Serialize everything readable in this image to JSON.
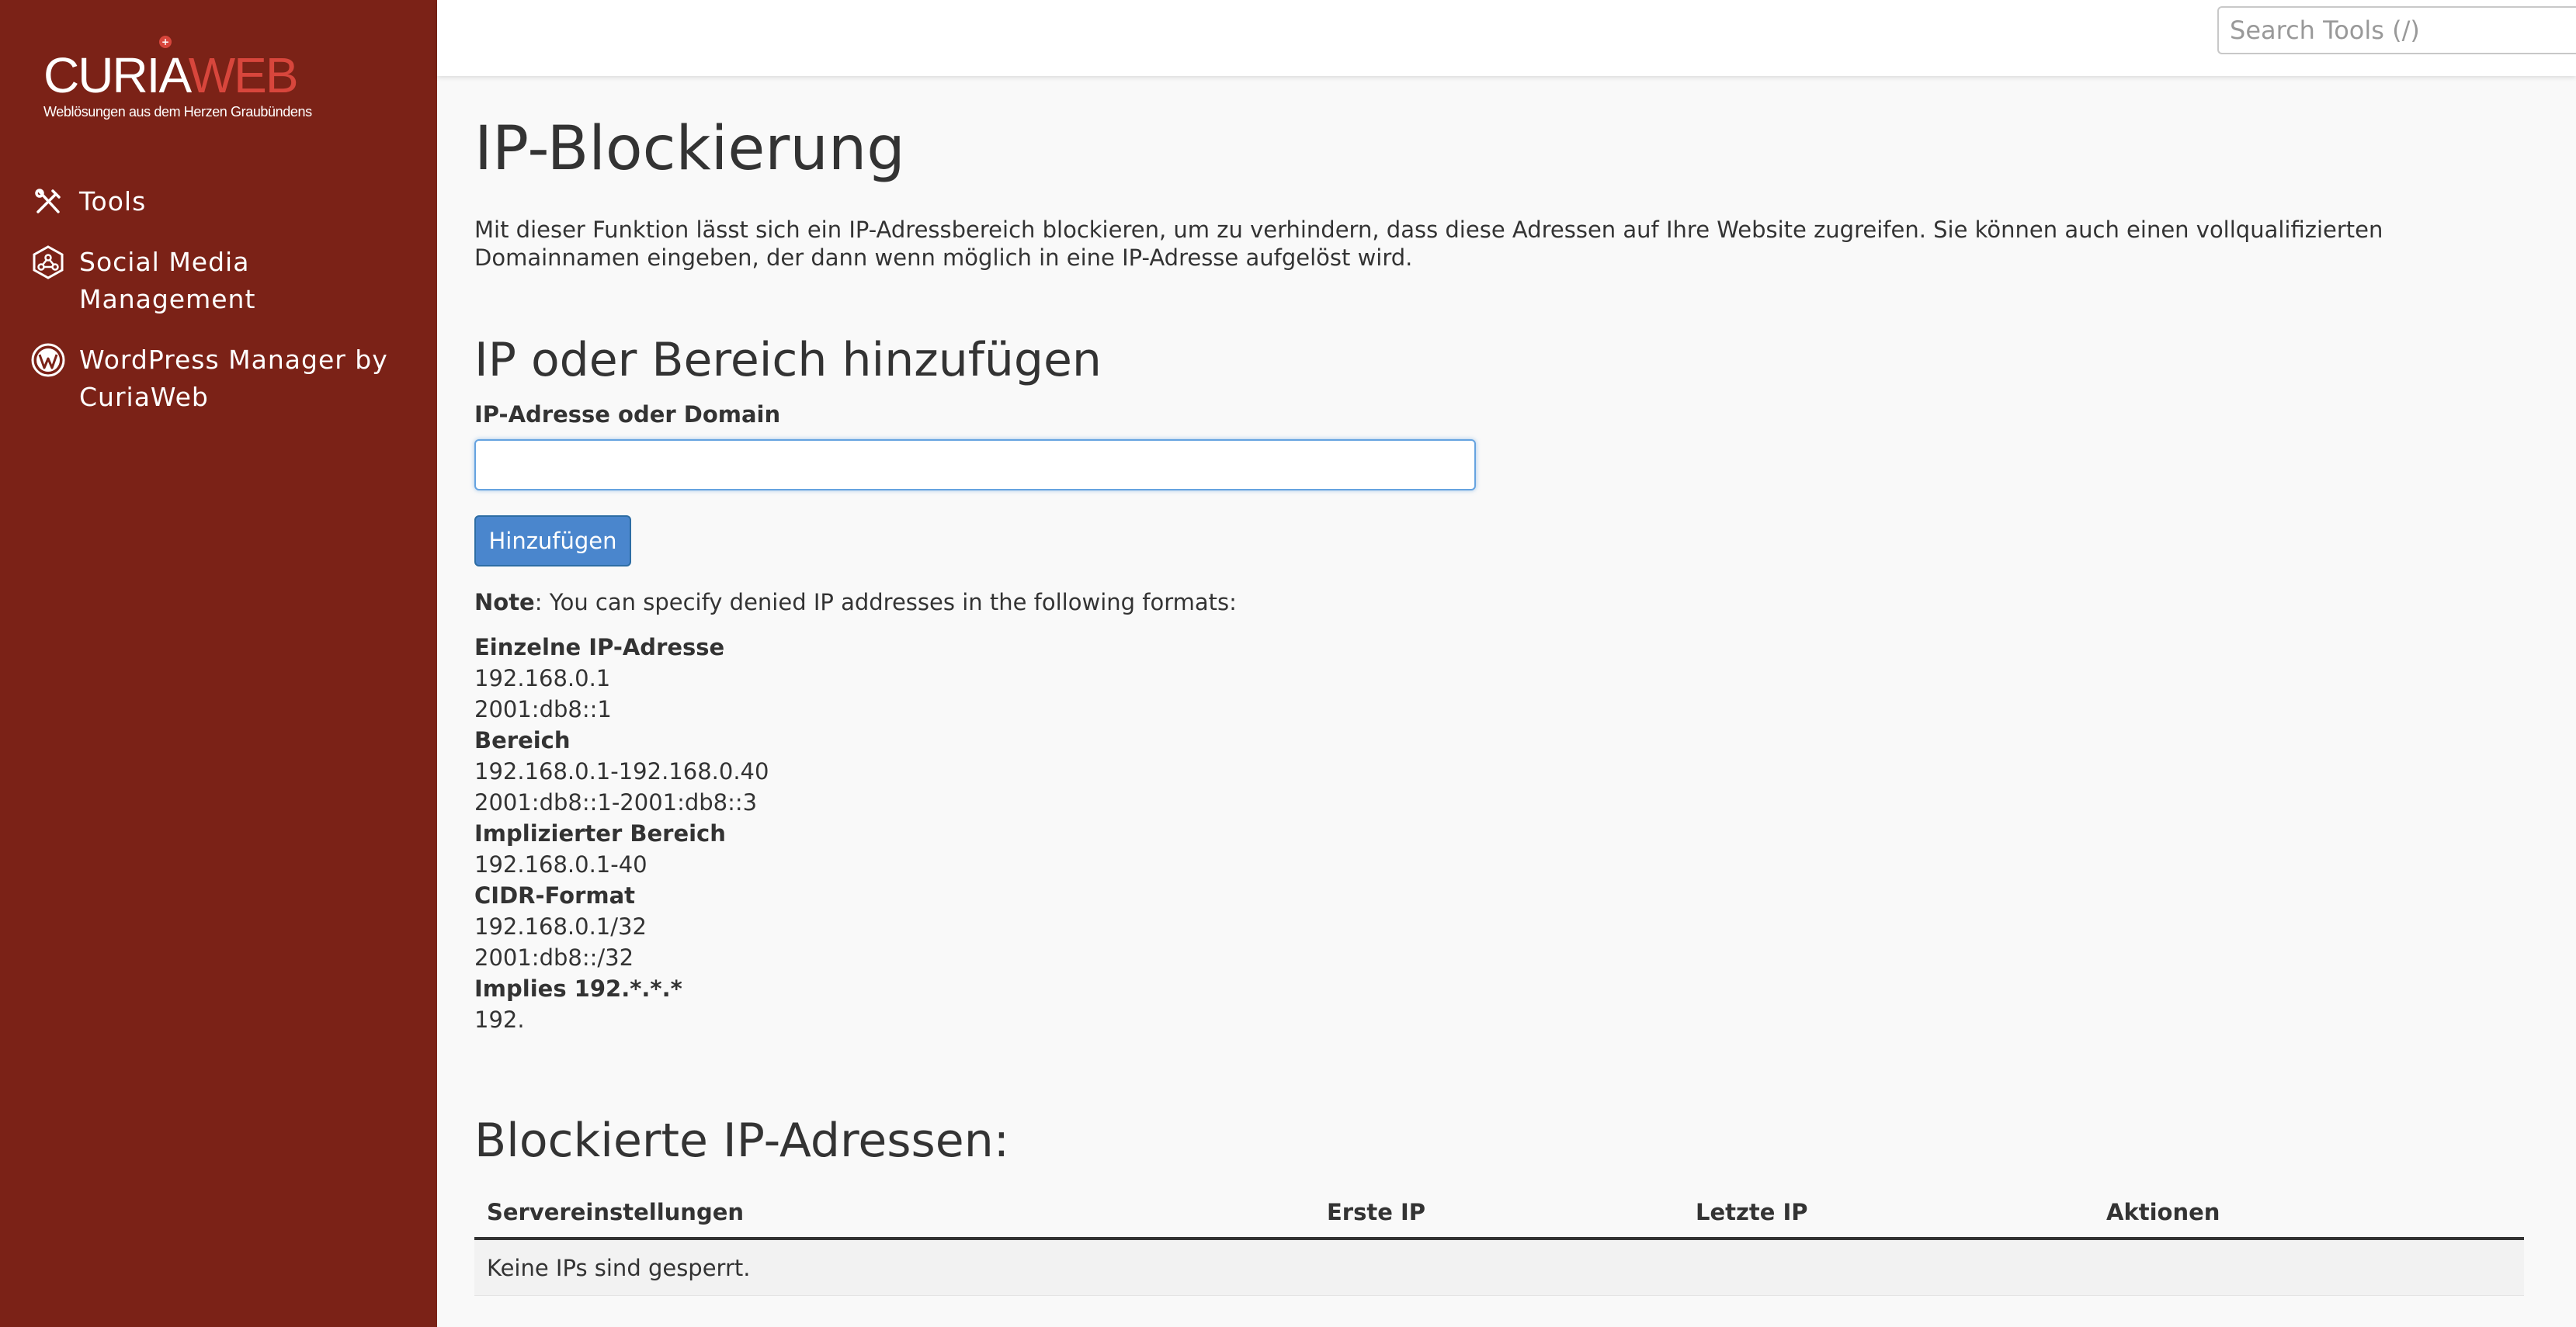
{
  "brand": {
    "name_part1": "CURIA",
    "name_part2": "WEB",
    "tagline": "Weblösungen aus dem Herzen Graubündens",
    "colors": {
      "sidebar": "#7b2217",
      "accent": "#d8463c"
    }
  },
  "sidebar": {
    "items": [
      {
        "label": "Tools",
        "icon": "tools-icon"
      },
      {
        "label": "Social Media Management",
        "icon": "social-media-icon"
      },
      {
        "label": "WordPress Manager by CuriaWeb",
        "icon": "wordpress-icon"
      }
    ]
  },
  "search": {
    "placeholder": "Search Tools (/)",
    "value": ""
  },
  "page": {
    "title": "IP-Blockierung",
    "description": "Mit dieser Funktion lässt sich ein IP-Adressbereich blockieren, um zu verhindern, dass diese Adressen auf Ihre Website zugreifen. Sie können auch einen vollqualifizierten Domainnamen eingeben, der dann wenn möglich in eine IP-Adresse aufgelöst wird."
  },
  "add_section": {
    "title": "IP oder Bereich hinzufügen",
    "field_label": "IP-Adresse oder Domain",
    "field_value": "",
    "button_label": "Hinzufügen",
    "note_label": "Note",
    "note_text": ": You can specify denied IP addresses in the following formats:",
    "formats": [
      {
        "heading": "Einzelne IP-Adresse",
        "examples": [
          "192.168.0.1",
          "2001:db8::1"
        ]
      },
      {
        "heading": "Bereich",
        "examples": [
          "192.168.0.1-192.168.0.40",
          "2001:db8::1-2001:db8::3"
        ]
      },
      {
        "heading": "Implizierter Bereich",
        "examples": [
          "192.168.0.1-40"
        ]
      },
      {
        "heading": "CIDR-Format",
        "examples": [
          "192.168.0.1/32",
          "2001:db8::/32"
        ]
      },
      {
        "heading": "Implies 192.*.*.*",
        "examples": [
          "192."
        ]
      }
    ]
  },
  "blocked_section": {
    "title": "Blockierte IP-Adressen:",
    "columns": [
      "Servereinstellungen",
      "Erste IP",
      "Letzte IP",
      "Aktionen"
    ],
    "empty_message": "Keine IPs sind gesperrt."
  }
}
